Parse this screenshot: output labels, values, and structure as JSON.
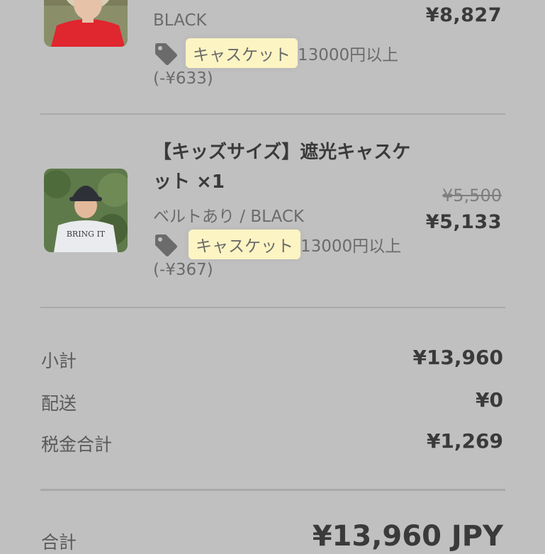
{
  "items": [
    {
      "variant": "BLACK",
      "price": "¥8,827",
      "discount_name": "キャスケット",
      "discount_condition": "13000円以上",
      "discount_amount": "(-¥633)"
    },
    {
      "title": "【キッズサイズ】遮光キャスケット ×1",
      "variant": "ベルトあり / BLACK",
      "original_price": "¥5,500",
      "price": "¥5,133",
      "discount_name": "キャスケット",
      "discount_condition": "13000円以上",
      "discount_amount": "(-¥367)",
      "image_text": "BRING IT"
    }
  ],
  "summary": {
    "subtotal_label": "小計",
    "subtotal_value": "¥13,960",
    "shipping_label": "配送",
    "shipping_value": "¥0",
    "tax_label": "税金合計",
    "tax_value": "¥1,269"
  },
  "total": {
    "label": "合計",
    "value": "¥13,960 JPY"
  },
  "icons": {
    "discount": "price-tag-icon"
  },
  "colors": {
    "background": "#c0c0c0",
    "discount_highlight": "#fdf4c3",
    "text": "#3a3a3a"
  }
}
